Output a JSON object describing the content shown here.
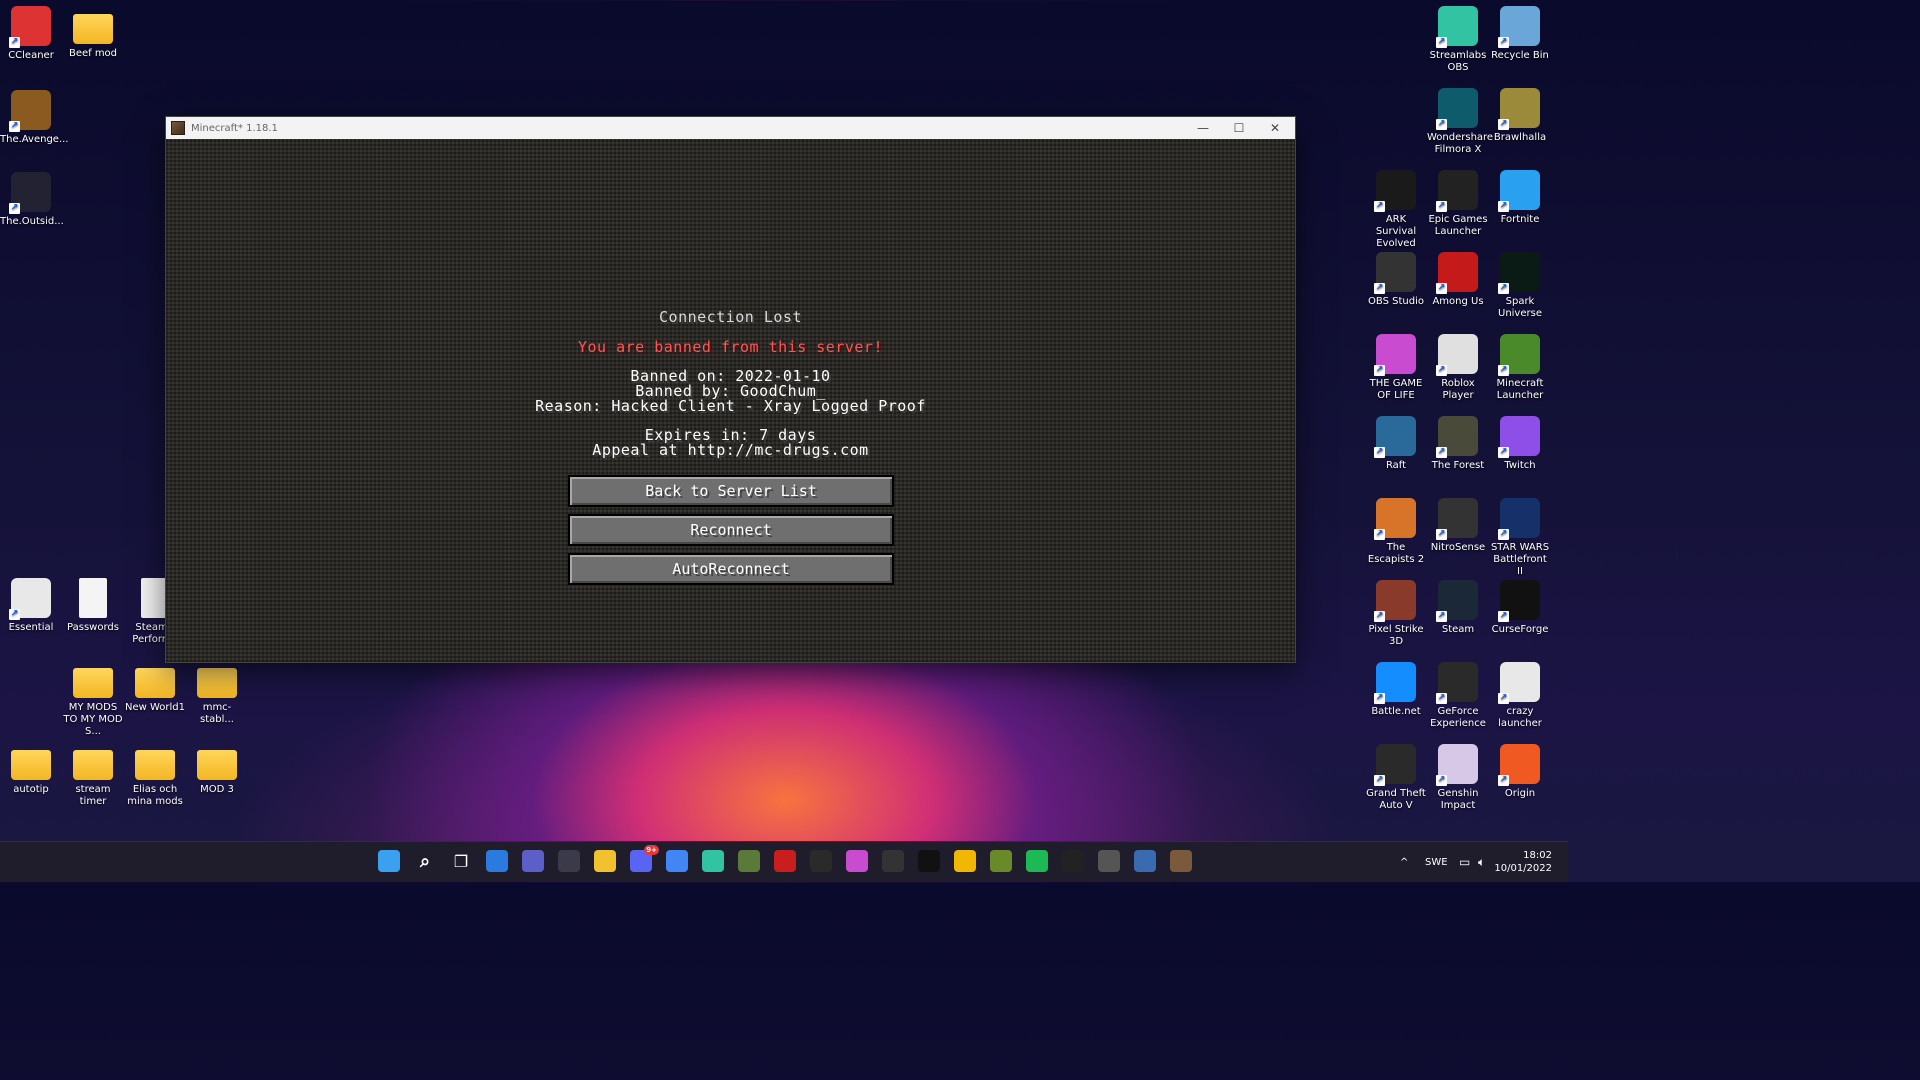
{
  "desktop": {
    "left_icons": [
      {
        "label": "CCleaner",
        "color": "#d33"
      },
      {
        "label": "Beef mod",
        "type": "folder"
      },
      {
        "label": "The.Avenge...",
        "color": "#8a5a20"
      },
      {
        "label": "The.Outsid...",
        "color": "#223"
      },
      {
        "label": "Essential",
        "color": "#e8e8e8"
      },
      {
        "label": "Passwords",
        "type": "doc"
      },
      {
        "label": "SteamV Performa",
        "type": "doc"
      },
      {
        "label": "MY MODS TO MY MOD S...",
        "type": "folder"
      },
      {
        "label": "New World1",
        "type": "folder"
      },
      {
        "label": "mmc-stabl...",
        "type": "folder"
      },
      {
        "label": "autotip",
        "type": "folder"
      },
      {
        "label": "stream timer",
        "type": "folder"
      },
      {
        "label": "Elias och mina mods",
        "type": "folder"
      },
      {
        "label": "MOD 3",
        "type": "folder"
      }
    ],
    "right_icons": [
      {
        "label": "Streamlabs OBS",
        "color": "#31c3a2"
      },
      {
        "label": "Recycle Bin",
        "color": "#6aa7d8"
      },
      {
        "label": "Wondershare Filmora X",
        "color": "#0d5b6b"
      },
      {
        "label": "Brawlhalla",
        "color": "#9a8a3a"
      },
      {
        "label": "ARK Survival Evolved",
        "color": "#1a1a1a"
      },
      {
        "label": "Epic Games Launcher",
        "color": "#222"
      },
      {
        "label": "Fortnite",
        "color": "#2aa0f0"
      },
      {
        "label": "OBS Studio",
        "color": "#333"
      },
      {
        "label": "Among Us",
        "color": "#c41a1a"
      },
      {
        "label": "Spark Universe",
        "color": "#0a1a14"
      },
      {
        "label": "THE GAME OF LIFE",
        "color": "#c84bd0"
      },
      {
        "label": "Roblox Player",
        "color": "#e0e0e0"
      },
      {
        "label": "Minecraft Launcher",
        "color": "#4a8a2a"
      },
      {
        "label": "Raft",
        "color": "#2a6a9a"
      },
      {
        "label": "The Forest",
        "color": "#4a4a3a"
      },
      {
        "label": "Twitch",
        "color": "#8d4fe8"
      },
      {
        "label": "The Escapists 2",
        "color": "#d8742a"
      },
      {
        "label": "NitroSense",
        "color": "#333"
      },
      {
        "label": "STAR WARS Battlefront II",
        "color": "#16306a"
      },
      {
        "label": "Pixel Strike 3D",
        "color": "#8a3a2a"
      },
      {
        "label": "Steam",
        "color": "#1b2838"
      },
      {
        "label": "CurseForge",
        "color": "#111"
      },
      {
        "label": "Battle.net",
        "color": "#148eff"
      },
      {
        "label": "GeForce Experience",
        "color": "#2a2a2a"
      },
      {
        "label": "crazy launcher",
        "color": "#e8e8e8"
      },
      {
        "label": "Grand Theft Auto V",
        "color": "#2a2a2a"
      },
      {
        "label": "Genshin Impact",
        "color": "#d8c8e8"
      },
      {
        "label": "Origin",
        "color": "#f05a22"
      }
    ]
  },
  "window": {
    "title": "Minecraft* 1.18.1",
    "minimize": "—",
    "maximize": "☐",
    "close": "✕"
  },
  "screen": {
    "heading": "Connection Lost",
    "banned_msg": "You are banned from this server!",
    "banned_on": "Banned on: 2022-01-10",
    "banned_by": "Banned by: GoodChum_",
    "reason": "Reason: Hacked Client - Xray Logged Proof",
    "expires": "Expires in: 7 days",
    "appeal": "Appeal at http://mc-drugs.com",
    "buttons": {
      "back": "Back to Server List",
      "reconnect": "Reconnect",
      "auto": "AutoReconnect"
    }
  },
  "taskbar": {
    "apps": [
      {
        "name": "windows-start",
        "color": "#3aa0f0"
      },
      {
        "name": "search",
        "color": "transparent"
      },
      {
        "name": "task-view",
        "color": "transparent"
      },
      {
        "name": "widgets",
        "color": "#2a7ae0"
      },
      {
        "name": "teams-chat",
        "color": "#5b5fc7"
      },
      {
        "name": "store",
        "color": "#3a3a4a"
      },
      {
        "name": "file-explorer",
        "color": "#f2c12e"
      },
      {
        "name": "discord",
        "color": "#5865f2",
        "badge": "9+"
      },
      {
        "name": "chrome",
        "color": "#4285f4"
      },
      {
        "name": "streamlabs",
        "color": "#31c3a2"
      },
      {
        "name": "minecraft",
        "color": "#5a7a3a"
      },
      {
        "name": "filezilla",
        "color": "#c81e1e"
      },
      {
        "name": "epic",
        "color": "#2a2a2a"
      },
      {
        "name": "game-of-life",
        "color": "#c84bd0"
      },
      {
        "name": "obs",
        "color": "#333"
      },
      {
        "name": "netflix",
        "color": "#111"
      },
      {
        "name": "rockstar",
        "color": "#f2b705"
      },
      {
        "name": "mod-manager",
        "color": "#6a8a2a"
      },
      {
        "name": "spark",
        "color": "#1db954"
      },
      {
        "name": "app-dark",
        "color": "#222"
      },
      {
        "name": "app-gray",
        "color": "#555"
      },
      {
        "name": "photos",
        "color": "#3a6ab0"
      },
      {
        "name": "minecraft-java",
        "color": "#7a5a3a"
      }
    ],
    "tray_chevron": "^",
    "language": "SWE",
    "time": "18:02",
    "date": "10/01/2022"
  }
}
